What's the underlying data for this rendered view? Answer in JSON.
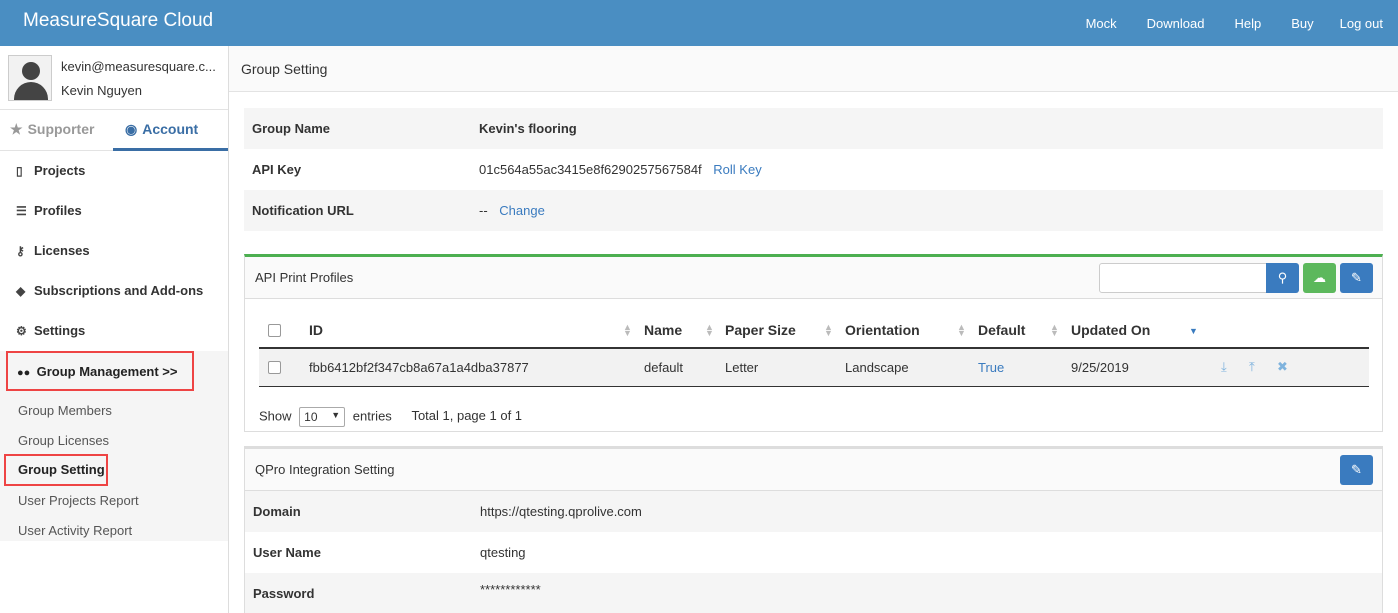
{
  "app": {
    "brand": "MeasureSquare Cloud",
    "nav": [
      "Mock",
      "Download",
      "Help",
      "Buy",
      "Log out"
    ],
    "accent": "#4a8ec2"
  },
  "sidebar": {
    "user_email": "kevin@measuresquare.c...",
    "user_name": "Kevin Nguyen",
    "tabs": {
      "supporter": "Supporter",
      "account": "Account"
    },
    "items": [
      {
        "label": "Projects",
        "icon": "file-icon"
      },
      {
        "label": "Profiles",
        "icon": "database-icon"
      },
      {
        "label": "Licenses",
        "icon": "key-icon"
      },
      {
        "label": "Subscriptions and Add-ons",
        "icon": "tags-icon"
      },
      {
        "label": "Settings",
        "icon": "gear-icon"
      }
    ],
    "group_management": "Group Management >>",
    "group_items": [
      "Group Members",
      "Group Licenses",
      "Group Setting",
      "User Projects Report",
      "User Activity Report"
    ]
  },
  "main": {
    "title": "Group Setting",
    "group_info": {
      "name_label": "Group Name",
      "name_value": "Kevin's flooring",
      "api_label": "API Key",
      "api_value": "01c564a55ac3415e8f6290257567584f",
      "roll_key": "Roll Key",
      "url_label": "Notification URL",
      "url_value": "--",
      "change": "Change"
    },
    "print_profiles": {
      "title": "API Print Profiles",
      "search_placeholder": "",
      "columns": [
        "ID",
        "Name",
        "Paper Size",
        "Orientation",
        "Default",
        "Updated On"
      ],
      "rows": [
        {
          "id": "fbb6412bf2f347cb8a67a1a4dba37877",
          "name": "default",
          "paper": "Letter",
          "orientation": "Landscape",
          "default": "True",
          "updated": "9/25/2019"
        }
      ],
      "show": "Show",
      "page_size": "10",
      "entries": "entries",
      "total": "Total 1, page 1 of 1"
    },
    "qpro": {
      "title": "QPro Integration Setting",
      "domain_label": "Domain",
      "domain_value": "https://qtesting.qprolive.com",
      "user_label": "User Name",
      "user_value": "qtesting",
      "pass_label": "Password",
      "pass_value": "************"
    }
  }
}
